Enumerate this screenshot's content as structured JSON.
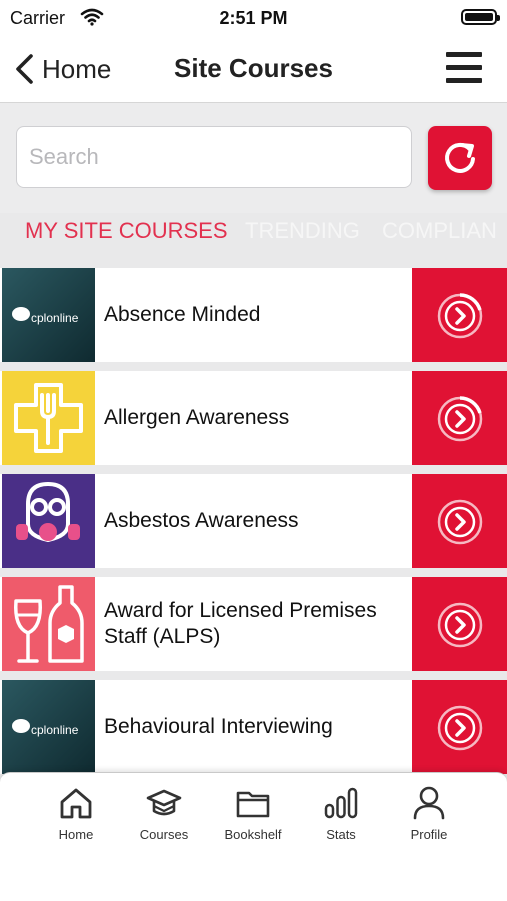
{
  "status_bar": {
    "carrier": "Carrier",
    "time": "2:51 PM"
  },
  "nav": {
    "back_label": "Home",
    "title": "Site Courses"
  },
  "search": {
    "placeholder": "Search"
  },
  "tabs": [
    {
      "label": "MY SITE COURSES",
      "active": true
    },
    {
      "label": "TRENDING",
      "active": false
    },
    {
      "label": "COMPLIAN",
      "active": false
    }
  ],
  "courses": [
    {
      "title": "Absence Minded",
      "thumbnail": "cplonline-logo",
      "logo_text": "cplonline"
    },
    {
      "title": "Allergen Awareness",
      "thumbnail": "fork-cross-icon"
    },
    {
      "title": "Asbestos Awareness",
      "thumbnail": "respirator-mask-icon"
    },
    {
      "title": "Award for Licensed Premises Staff (ALPS)",
      "thumbnail": "wine-bottle-icon"
    },
    {
      "title": "Behavioural Interviewing",
      "thumbnail": "cplonline-logo",
      "logo_text": "cplonline"
    }
  ],
  "bottom_tabs": [
    {
      "label": "Home",
      "icon": "home-icon"
    },
    {
      "label": "Courses",
      "icon": "graduation-cap-icon"
    },
    {
      "label": "Bookshelf",
      "icon": "folder-icon"
    },
    {
      "label": "Stats",
      "icon": "bar-chart-icon"
    },
    {
      "label": "Profile",
      "icon": "person-icon"
    }
  ],
  "colors": {
    "accent": "#e01234",
    "active_tab": "#e2314f"
  }
}
